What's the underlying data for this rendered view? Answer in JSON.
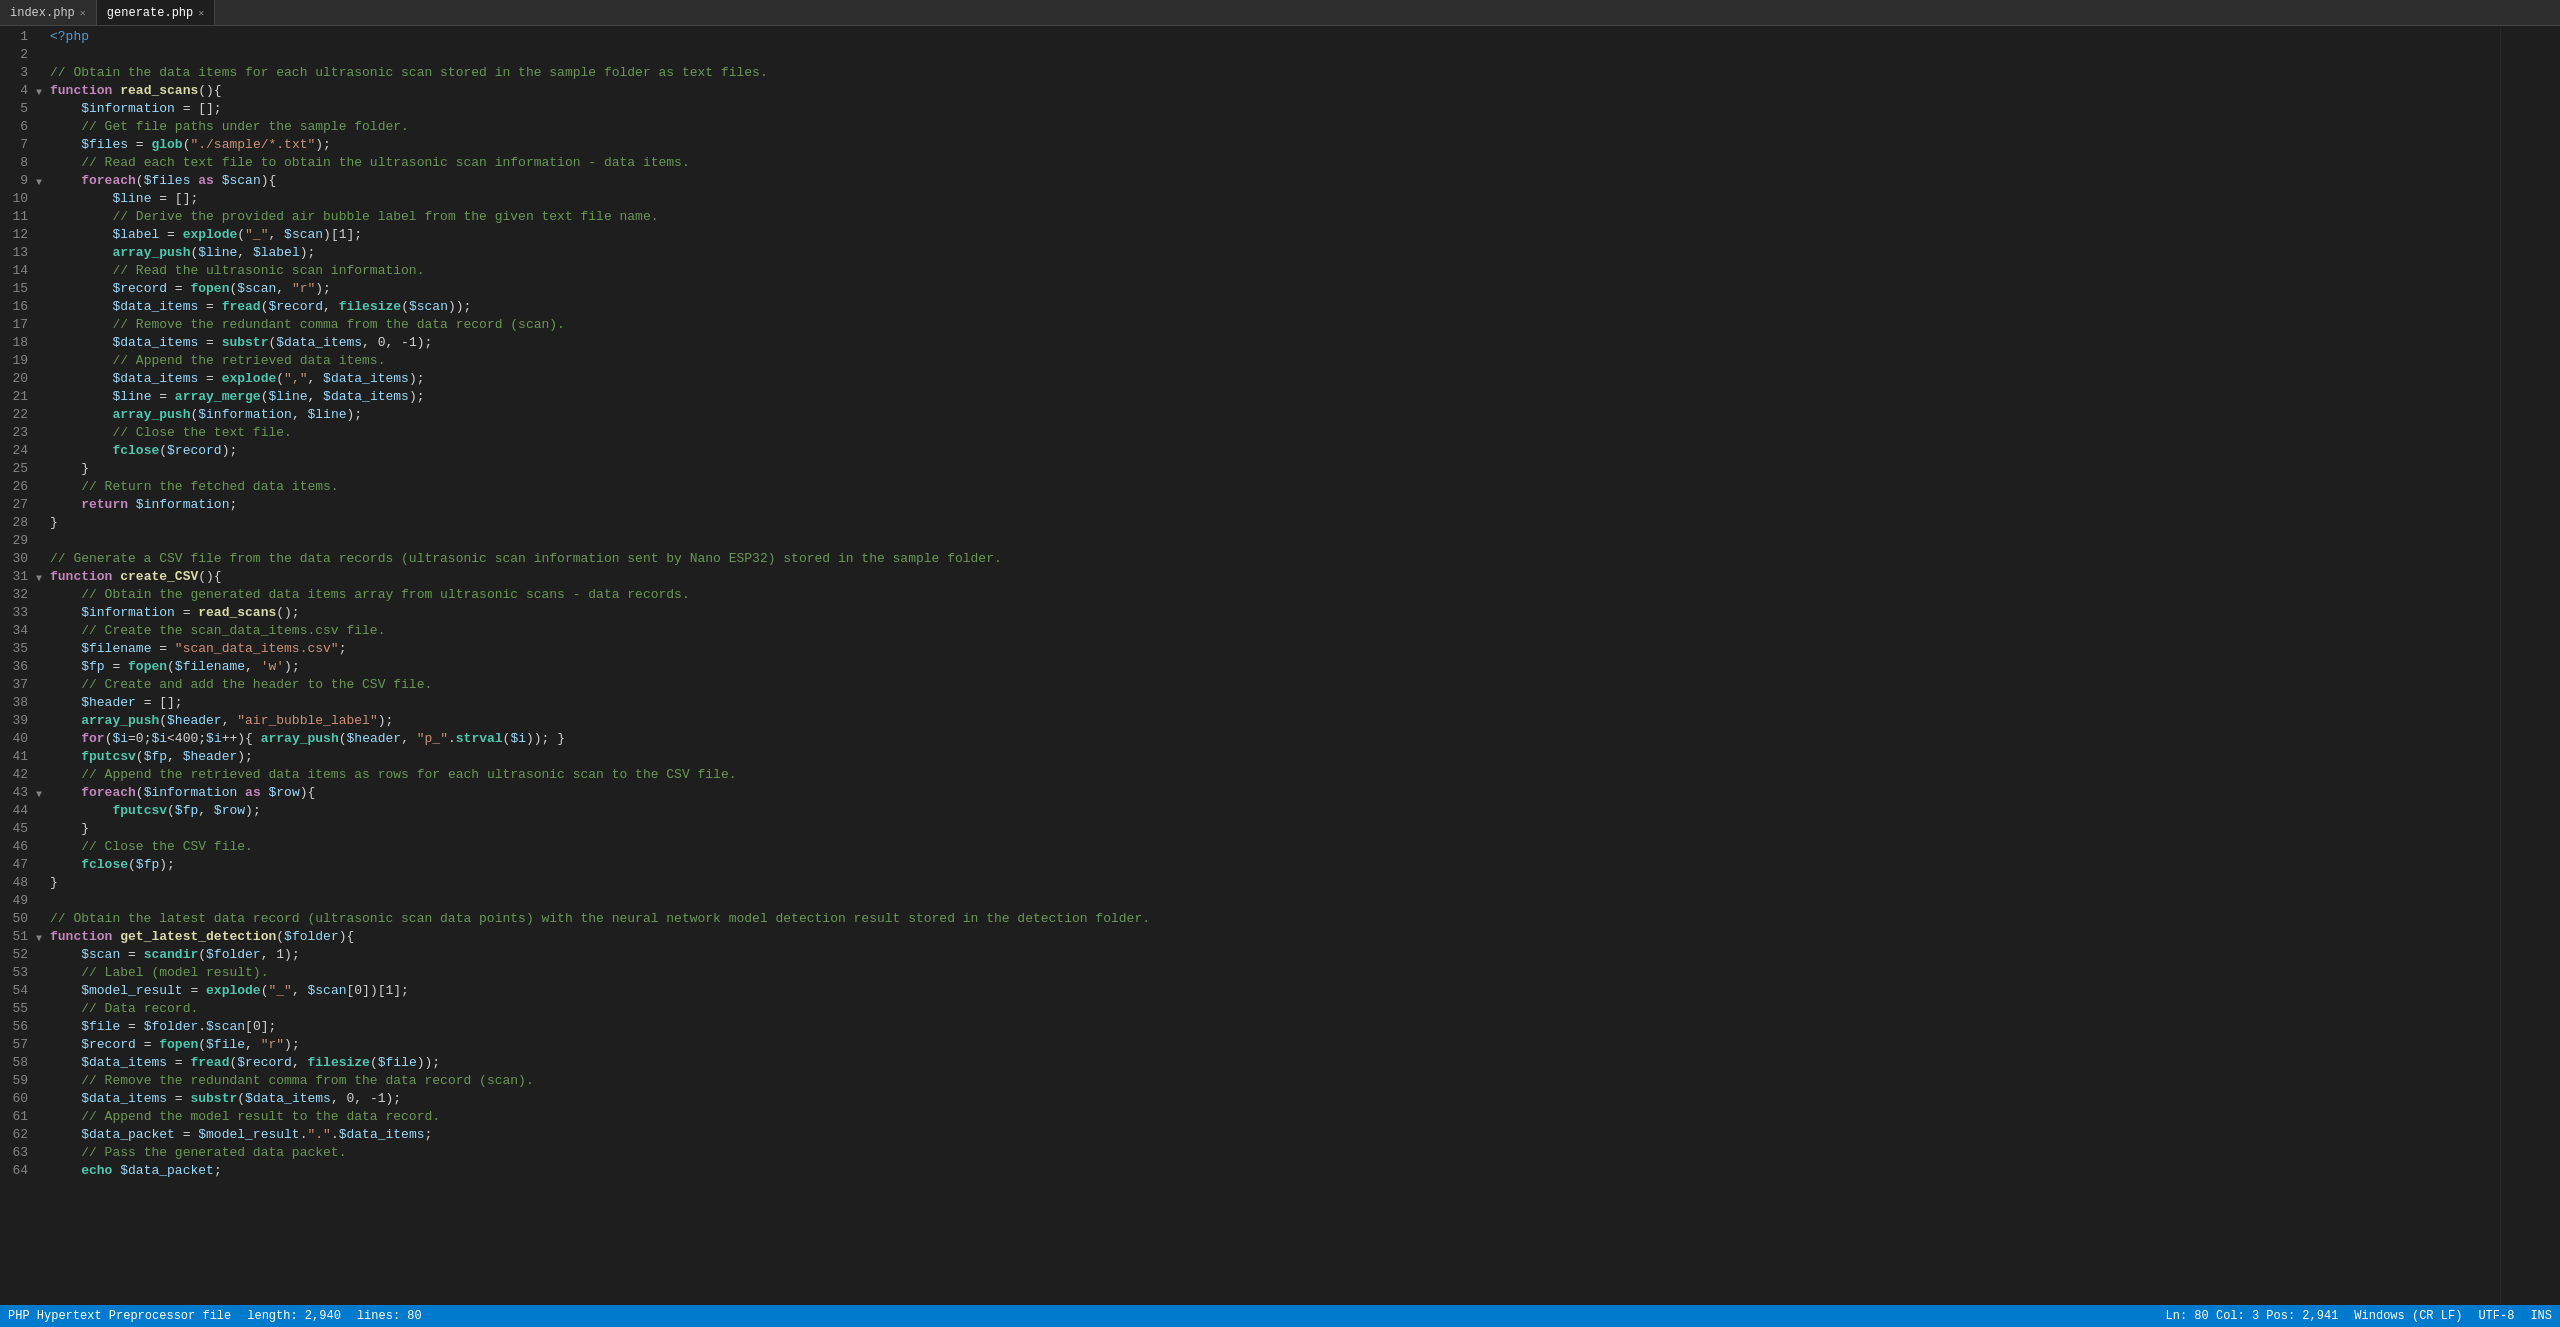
{
  "tabs": [
    {
      "label": "index.php",
      "active": false,
      "closable": true
    },
    {
      "label": "generate.php",
      "active": true,
      "closable": true
    }
  ],
  "status": {
    "left": [
      {
        "key": "length",
        "label": "length: 2,940"
      },
      {
        "key": "lines",
        "label": "lines: 80"
      }
    ],
    "right": [
      {
        "key": "position",
        "label": "Ln: 80  Col: 3  Pos: 2,941"
      },
      {
        "key": "eol",
        "label": "Windows (CR LF)"
      },
      {
        "key": "encoding",
        "label": "UTF-8"
      },
      {
        "key": "mode",
        "label": "INS"
      }
    ],
    "language": "PHP Hypertext Preprocessor file"
  },
  "lines": [
    {
      "num": 1,
      "fold": false,
      "html": "<span class='php-tag'>&lt;?php</span>"
    },
    {
      "num": 2,
      "fold": false,
      "html": ""
    },
    {
      "num": 3,
      "fold": false,
      "html": "<span class='comment'>// Obtain the data items for each ultrasonic scan stored in the sample folder as text files.</span>"
    },
    {
      "num": 4,
      "fold": true,
      "html": "<span class='keyword'>function</span> <span class='function-name'>read_scans</span>(){"
    },
    {
      "num": 5,
      "fold": false,
      "html": "    <span class='variable'>$information</span> = [];"
    },
    {
      "num": 6,
      "fold": false,
      "html": "    <span class='comment'>// Get file paths under the sample folder.</span>"
    },
    {
      "num": 7,
      "fold": false,
      "html": "    <span class='variable'>$files</span> = <span class='builtin'>glob</span>(<span class='string'>\"./sample/*.txt\"</span>);"
    },
    {
      "num": 8,
      "fold": false,
      "html": "    <span class='comment'>// Read each text file to obtain the ultrasonic scan information - data items.</span>"
    },
    {
      "num": 9,
      "fold": true,
      "html": "    <span class='keyword'>foreach</span>(<span class='variable'>$files</span> <span class='keyword'>as</span> <span class='variable'>$scan</span>){"
    },
    {
      "num": 10,
      "fold": false,
      "html": "        <span class='variable'>$line</span> = [];"
    },
    {
      "num": 11,
      "fold": false,
      "html": "        <span class='comment'>// Derive the provided air bubble label from the given text file name.</span>"
    },
    {
      "num": 12,
      "fold": false,
      "html": "        <span class='variable'>$label</span> = <span class='builtin'>explode</span>(<span class='string'>\"_\"</span>, <span class='variable'>$scan</span>)[1];"
    },
    {
      "num": 13,
      "fold": false,
      "html": "        <span class='builtin'>array_push</span>(<span class='variable'>$line</span>, <span class='variable'>$label</span>);"
    },
    {
      "num": 14,
      "fold": false,
      "html": "        <span class='comment'>// Read the ultrasonic scan information.</span>"
    },
    {
      "num": 15,
      "fold": false,
      "html": "        <span class='variable'>$record</span> = <span class='builtin'>fopen</span>(<span class='variable'>$scan</span>, <span class='string'>\"r\"</span>);"
    },
    {
      "num": 16,
      "fold": false,
      "html": "        <span class='variable'>$data_items</span> = <span class='builtin'>fread</span>(<span class='variable'>$record</span>, <span class='builtin'>filesize</span>(<span class='variable'>$scan</span>));"
    },
    {
      "num": 17,
      "fold": false,
      "html": "        <span class='comment'>// Remove the redundant comma from the data record (scan).</span>"
    },
    {
      "num": 18,
      "fold": false,
      "html": "        <span class='variable'>$data_items</span> = <span class='builtin'>substr</span>(<span class='variable'>$data_items</span>, 0, -1);"
    },
    {
      "num": 19,
      "fold": false,
      "html": "        <span class='comment'>// Append the retrieved data items.</span>"
    },
    {
      "num": 20,
      "fold": false,
      "html": "        <span class='variable'>$data_items</span> = <span class='builtin'>explode</span>(<span class='string'>\",\"</span>, <span class='variable'>$data_items</span>);"
    },
    {
      "num": 21,
      "fold": false,
      "html": "        <span class='variable'>$line</span> = <span class='builtin'>array_merge</span>(<span class='variable'>$line</span>, <span class='variable'>$data_items</span>);"
    },
    {
      "num": 22,
      "fold": false,
      "html": "        <span class='builtin'>array_push</span>(<span class='variable'>$information</span>, <span class='variable'>$line</span>);"
    },
    {
      "num": 23,
      "fold": false,
      "html": "        <span class='comment'>// Close the text file.</span>"
    },
    {
      "num": 24,
      "fold": false,
      "html": "        <span class='builtin'>fclose</span>(<span class='variable'>$record</span>);"
    },
    {
      "num": 25,
      "fold": false,
      "html": "    }"
    },
    {
      "num": 26,
      "fold": false,
      "html": "    <span class='comment'>// Return the fetched data items.</span>"
    },
    {
      "num": 27,
      "fold": false,
      "html": "    <span class='keyword'>return</span> <span class='variable'>$information</span>;"
    },
    {
      "num": 28,
      "fold": false,
      "html": "}"
    },
    {
      "num": 29,
      "fold": false,
      "html": ""
    },
    {
      "num": 30,
      "fold": false,
      "html": "<span class='comment'>// Generate a CSV file from the data records (ultrasonic scan information sent by Nano ESP32) stored in the sample folder.</span>"
    },
    {
      "num": 31,
      "fold": true,
      "html": "<span class='keyword'>function</span> <span class='function-name'>create_CSV</span>(){"
    },
    {
      "num": 32,
      "fold": false,
      "html": "    <span class='comment'>// Obtain the generated data items array from ultrasonic scans - data records.</span>"
    },
    {
      "num": 33,
      "fold": false,
      "html": "    <span class='variable'>$information</span> = <span class='function-name'>read_scans</span>();"
    },
    {
      "num": 34,
      "fold": false,
      "html": "    <span class='comment'>// Create the scan_data_items.csv file.</span>"
    },
    {
      "num": 35,
      "fold": false,
      "html": "    <span class='variable'>$filename</span> = <span class='string'>\"scan_data_items.csv\"</span>;"
    },
    {
      "num": 36,
      "fold": false,
      "html": "    <span class='variable'>$fp</span> = <span class='builtin'>fopen</span>(<span class='variable'>$filename</span>, <span class='string'>'w'</span>);"
    },
    {
      "num": 37,
      "fold": false,
      "html": "    <span class='comment'>// Create and add the header to the CSV file.</span>"
    },
    {
      "num": 38,
      "fold": false,
      "html": "    <span class='variable'>$header</span> = [];"
    },
    {
      "num": 39,
      "fold": false,
      "html": "    <span class='builtin'>array_push</span>(<span class='variable'>$header</span>, <span class='string'>\"air_bubble_label\"</span>);"
    },
    {
      "num": 40,
      "fold": false,
      "html": "    <span class='keyword'>for</span>(<span class='variable'>$i</span>=0;<span class='variable'>$i</span>&lt;400;<span class='variable'>$i</span>++){ <span class='builtin'>array_push</span>(<span class='variable'>$header</span>, <span class='string'>\"p_\"</span>.<span class='builtin'>strval</span>(<span class='variable'>$i</span>)); }"
    },
    {
      "num": 41,
      "fold": false,
      "html": "    <span class='builtin'>fputcsv</span>(<span class='variable'>$fp</span>, <span class='variable'>$header</span>);"
    },
    {
      "num": 42,
      "fold": false,
      "html": "    <span class='comment'>// Append the retrieved data items as rows for each ultrasonic scan to the CSV file.</span>"
    },
    {
      "num": 43,
      "fold": true,
      "html": "    <span class='keyword'>foreach</span>(<span class='variable'>$information</span> <span class='keyword'>as</span> <span class='variable'>$row</span>){"
    },
    {
      "num": 44,
      "fold": false,
      "html": "        <span class='builtin'>fputcsv</span>(<span class='variable'>$fp</span>, <span class='variable'>$row</span>);"
    },
    {
      "num": 45,
      "fold": false,
      "html": "    }"
    },
    {
      "num": 46,
      "fold": false,
      "html": "    <span class='comment'>// Close the CSV file.</span>"
    },
    {
      "num": 47,
      "fold": false,
      "html": "    <span class='builtin'>fclose</span>(<span class='variable'>$fp</span>);"
    },
    {
      "num": 48,
      "fold": false,
      "html": "}"
    },
    {
      "num": 49,
      "fold": false,
      "html": ""
    },
    {
      "num": 50,
      "fold": false,
      "html": "<span class='comment'>// Obtain the latest data record (ultrasonic scan data points) with the neural network model detection result stored in the detection folder.</span>"
    },
    {
      "num": 51,
      "fold": true,
      "html": "<span class='keyword'>function</span> <span class='function-name'>get_latest_detection</span>(<span class='variable'>$folder</span>){"
    },
    {
      "num": 52,
      "fold": false,
      "html": "    <span class='variable'>$scan</span> = <span class='builtin'>scandir</span>(<span class='variable'>$folder</span>, 1);"
    },
    {
      "num": 53,
      "fold": false,
      "html": "    <span class='comment'>// Label (model result).</span>"
    },
    {
      "num": 54,
      "fold": false,
      "html": "    <span class='variable'>$model_result</span> = <span class='builtin'>explode</span>(<span class='string'>\"_\"</span>, <span class='variable'>$scan</span>[0])[1];"
    },
    {
      "num": 55,
      "fold": false,
      "html": "    <span class='comment'>// Data record.</span>"
    },
    {
      "num": 56,
      "fold": false,
      "html": "    <span class='variable'>$file</span> = <span class='variable'>$folder</span>.<span class='variable'>$scan</span>[0];"
    },
    {
      "num": 57,
      "fold": false,
      "html": "    <span class='variable'>$record</span> = <span class='builtin'>fopen</span>(<span class='variable'>$file</span>, <span class='string'>\"r\"</span>);"
    },
    {
      "num": 58,
      "fold": false,
      "html": "    <span class='variable'>$data_items</span> = <span class='builtin'>fread</span>(<span class='variable'>$record</span>, <span class='builtin'>filesize</span>(<span class='variable'>$file</span>));"
    },
    {
      "num": 59,
      "fold": false,
      "html": "    <span class='comment'>// Remove the redundant comma from the data record (scan).</span>"
    },
    {
      "num": 60,
      "fold": false,
      "html": "    <span class='variable'>$data_items</span> = <span class='builtin'>substr</span>(<span class='variable'>$data_items</span>, 0, -1);"
    },
    {
      "num": 61,
      "fold": false,
      "html": "    <span class='comment'>// Append the model result to the data record.</span>"
    },
    {
      "num": 62,
      "fold": false,
      "html": "    <span class='variable'>$data_packet</span> = <span class='variable'>$model_result</span>.<span class='string'>\".\"</span>.<span class='variable'>$data_items</span>;"
    },
    {
      "num": 63,
      "fold": false,
      "html": "    <span class='comment'>// Pass the generated data packet.</span>"
    },
    {
      "num": 64,
      "fold": false,
      "html": "    <span class='builtin'>echo</span> <span class='variable'>$data_packet</span>;"
    }
  ]
}
